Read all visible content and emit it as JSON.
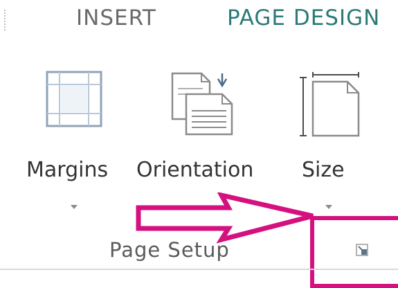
{
  "ribbon": {
    "tabs": [
      {
        "label": "INSERT",
        "active": false
      },
      {
        "label": "PAGE DESIGN",
        "active": true
      }
    ],
    "accent_color": "#2b7a78",
    "group": {
      "label": "Page Setup",
      "commands": [
        {
          "label": "Margins",
          "icon": "margins-icon",
          "has_dropdown": true
        },
        {
          "label": "Orientation",
          "icon": "orientation-icon",
          "has_dropdown": false
        },
        {
          "label": "Size",
          "icon": "page-size-icon",
          "has_dropdown": true
        }
      ],
      "dialog_launcher_icon": "dialog-launcher-icon"
    }
  },
  "annotation": {
    "color": "#d4117e",
    "arrow_icon": "arrow-right-outline",
    "highlight_target": "dialog-launcher"
  }
}
